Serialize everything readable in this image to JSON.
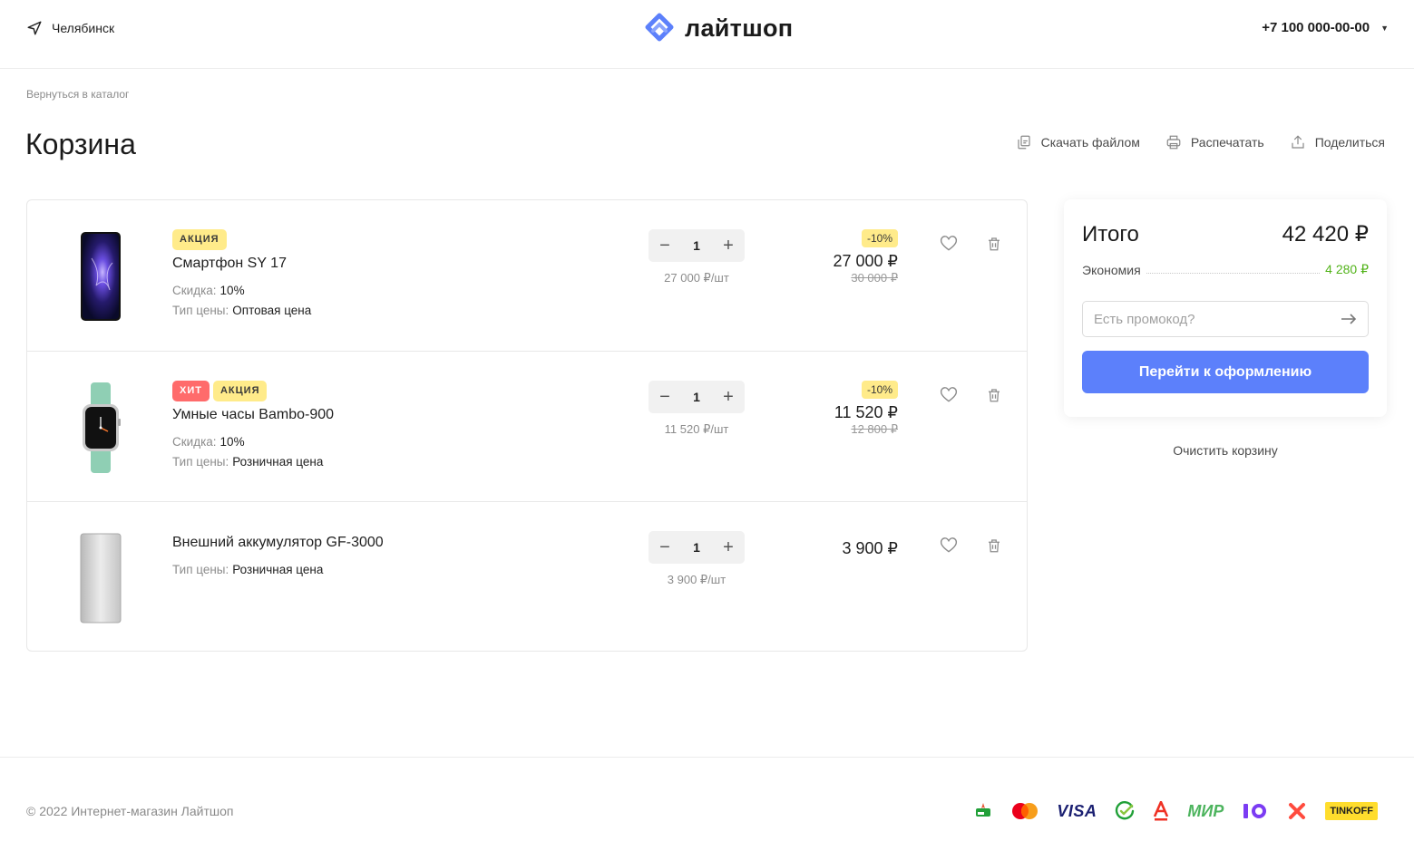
{
  "header": {
    "city": "Челябинск",
    "logo": "лайтшоп",
    "phone": "+7 100 000-00-00"
  },
  "breadcrumb": "Вернуться в каталог",
  "page_title": "Корзина",
  "actions": {
    "download": "Скачать файлом",
    "print": "Распечатать",
    "share": "Поделиться"
  },
  "cart": {
    "items": [
      {
        "badges": [
          "АКЦИЯ"
        ],
        "name": "Смартфон SY 17",
        "props": [
          {
            "k": "Скидка:",
            "v": "10%"
          },
          {
            "k": "Тип цены:",
            "v": "Оптовая цена"
          }
        ],
        "qty": "1",
        "unit_price": "27 000 ₽/шт",
        "discount": "-10%",
        "price": "27 000 ₽",
        "old_price": "30 000 ₽"
      },
      {
        "badges": [
          "ХИТ",
          "АКЦИЯ"
        ],
        "name": "Умные часы Bambo-900",
        "props": [
          {
            "k": "Скидка:",
            "v": "10%"
          },
          {
            "k": "Тип цены:",
            "v": "Розничная цена"
          }
        ],
        "qty": "1",
        "unit_price": "11 520 ₽/шт",
        "discount": "-10%",
        "price": "11 520 ₽",
        "old_price": "12 800 ₽"
      },
      {
        "badges": [],
        "name": "Внешний аккумулятор GF-3000",
        "props": [
          {
            "k": "Тип цены:",
            "v": "Розничная цена"
          }
        ],
        "qty": "1",
        "unit_price": "3 900 ₽/шт",
        "price": "3 900 ₽"
      }
    ]
  },
  "summary": {
    "total_label": "Итого",
    "total_value": "42 420 ₽",
    "economy_label": "Экономия",
    "economy_value": "4 280 ₽",
    "promo_placeholder": "Есть промокод?",
    "checkout_label": "Перейти к оформлению",
    "clear_label": "Очистить корзину"
  },
  "footer": {
    "copyright": "© 2022 Интернет-магазин Лайтшоп",
    "payments": {
      "visa": "VISA",
      "mir": "МИР",
      "tinkoff": "TINKOFF"
    }
  },
  "colors": {
    "accent": "#5c80fb",
    "badge_sale": "#ffeb8a",
    "badge_hit": "#ff6b6b",
    "economy": "#52b31a"
  }
}
